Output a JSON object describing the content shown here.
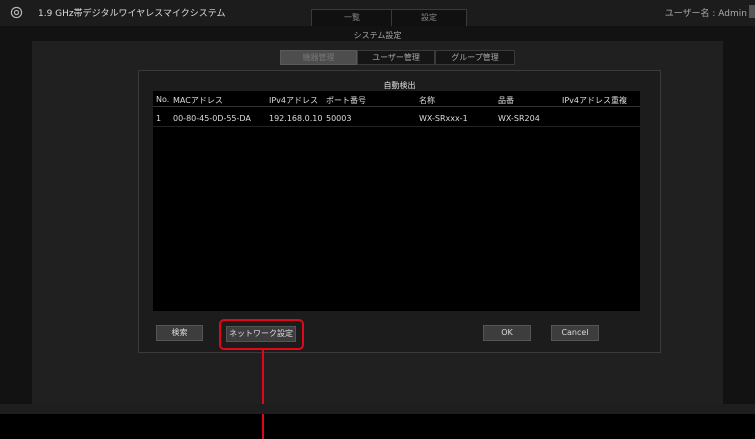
{
  "app": {
    "title": "1.9 GHz帯デジタルワイヤレスマイクシステム",
    "tabs": {
      "list": "一覧",
      "settings": "設定"
    },
    "user_label": "ユーザー名 : Admin"
  },
  "page": {
    "title": "システム設定",
    "sub_tabs": {
      "device": "機器管理",
      "user": "ユーザー管理",
      "group": "グループ管理"
    }
  },
  "dialog": {
    "title": "自動検出",
    "columns": {
      "no": "No.",
      "mac": "MACアドレス",
      "ipv4": "IPv4アドレス",
      "port": "ポート番号",
      "name": "名称",
      "model": "品番",
      "dup": "IPv4アドレス重複"
    },
    "rows": [
      {
        "no": "1",
        "mac": "00-80-45-0D-55-DA",
        "ipv4": "192.168.0.10",
        "port": "50003",
        "name": "WX-SRxxx-1",
        "model": "WX-SR204",
        "dup": ""
      }
    ],
    "buttons": {
      "search": "検索",
      "network": "ネットワーク設定",
      "ok": "OK",
      "cancel": "Cancel"
    }
  },
  "colors": {
    "callout": "#e2061b",
    "background": "#000000",
    "panel": "#202020"
  },
  "icons": {
    "settings": "gear-icon",
    "user_menu": "dropdown-arrow-icon"
  }
}
